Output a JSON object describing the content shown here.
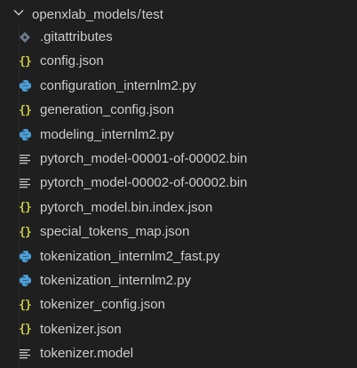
{
  "explorer": {
    "path": {
      "folder": "openxlab_models",
      "separator": "/",
      "subfolder": "test"
    },
    "files": [
      {
        "name": ".gitattributes",
        "icon": "git-diamond-icon"
      },
      {
        "name": "config.json",
        "icon": "json-braces-icon"
      },
      {
        "name": "configuration_internlm2.py",
        "icon": "python-icon"
      },
      {
        "name": "generation_config.json",
        "icon": "json-braces-icon"
      },
      {
        "name": "modeling_internlm2.py",
        "icon": "python-icon"
      },
      {
        "name": "pytorch_model-00001-of-00002.bin",
        "icon": "text-lines-icon"
      },
      {
        "name": "pytorch_model-00002-of-00002.bin",
        "icon": "text-lines-icon"
      },
      {
        "name": "pytorch_model.bin.index.json",
        "icon": "json-braces-icon"
      },
      {
        "name": "special_tokens_map.json",
        "icon": "json-braces-icon"
      },
      {
        "name": "tokenization_internlm2_fast.py",
        "icon": "python-icon"
      },
      {
        "name": "tokenization_internlm2.py",
        "icon": "python-icon"
      },
      {
        "name": "tokenizer_config.json",
        "icon": "json-braces-icon"
      },
      {
        "name": "tokenizer.json",
        "icon": "json-braces-icon"
      },
      {
        "name": "tokenizer.model",
        "icon": "text-lines-icon"
      }
    ],
    "colors": {
      "background": "#1f1f1f",
      "text": "#cccccc",
      "json_icon": "#cbcb41",
      "python_icon": "#4b9fd6",
      "git_icon": "#6b7b8c",
      "text_icon": "#c5c5c5"
    }
  }
}
